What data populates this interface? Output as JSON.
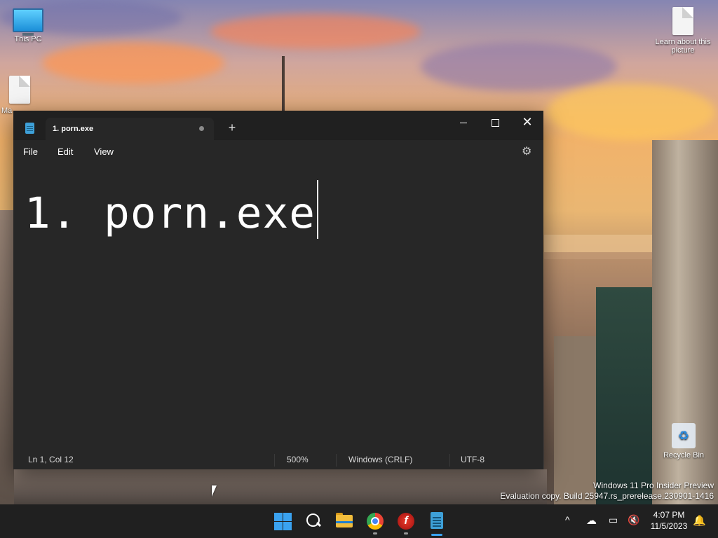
{
  "desktop": {
    "icons": [
      {
        "label": "This PC",
        "icon": "monitor-icon"
      },
      {
        "label": "Ma",
        "icon": "shortcut-file-icon"
      },
      {
        "label": "Learn about this picture",
        "icon": "document-icon"
      },
      {
        "label": "Recycle Bin",
        "icon": "recycle-bin-icon"
      }
    ],
    "watermark": {
      "line1": "Windows 11 Pro Insider Preview",
      "line2": "Evaluation copy. Build 25947.rs_prerelease.230901-1416"
    }
  },
  "notepad": {
    "tab_title": "1. porn.exe",
    "tab_unsaved_indicator": "●",
    "new_tab_label": "+",
    "window_controls": {
      "minimize": "minimize",
      "maximize": "maximize",
      "close": "✕"
    },
    "menu": {
      "file": "File",
      "edit": "Edit",
      "view": "View"
    },
    "settings_icon": "gear-icon",
    "content": "1. porn.exe",
    "status": {
      "position": "Ln 1, Col 12",
      "zoom": "500%",
      "line_ending": "Windows (CRLF)",
      "encoding": "UTF-8"
    }
  },
  "taskbar": {
    "apps": [
      "start-icon",
      "search-icon",
      "file-explorer-icon",
      "chrome-icon",
      "flash-icon",
      "notepad-icon"
    ],
    "tray": {
      "chevron": "^",
      "time": "4:07 PM",
      "date": "11/5/2023"
    },
    "colors": {
      "accent": "#3aa2f0",
      "taskbar_bg": "#202020"
    }
  }
}
